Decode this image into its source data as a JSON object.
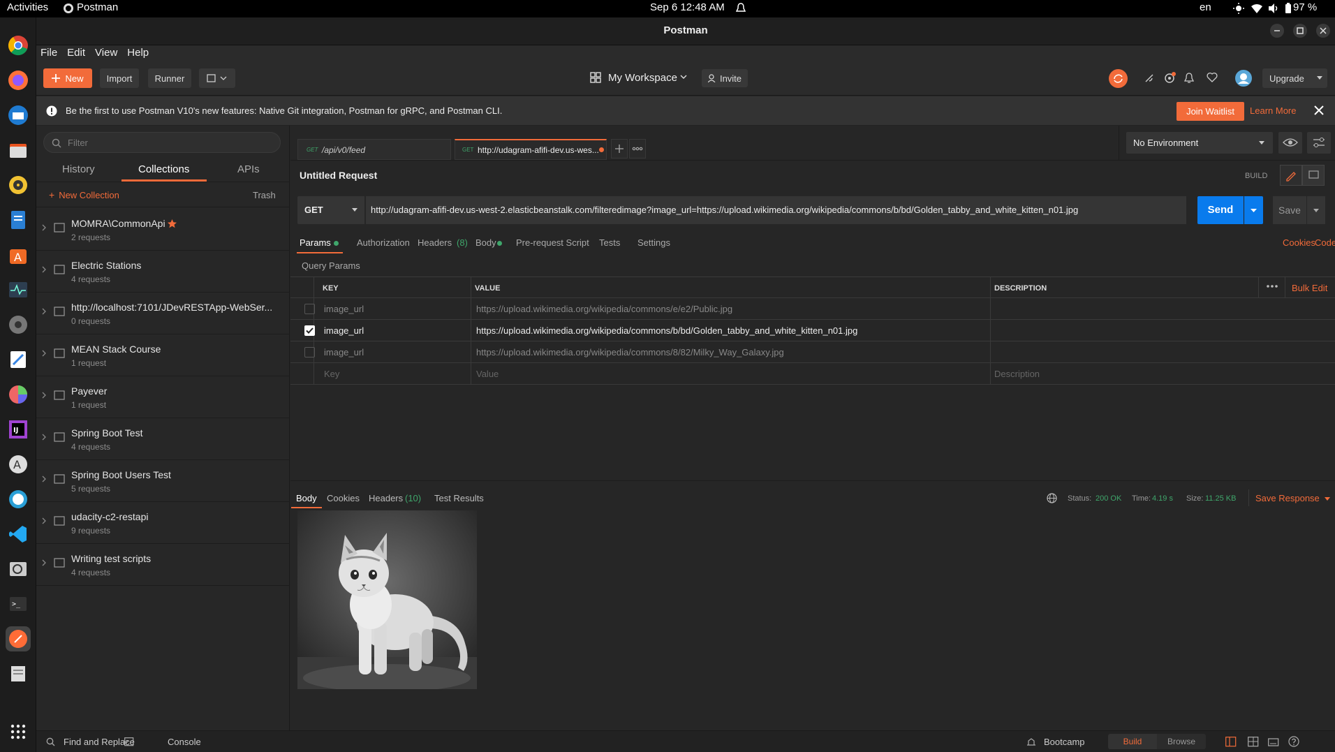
{
  "system": {
    "activities": "Activities",
    "app_name": "Postman",
    "clock": "Sep 6  12:48 AM",
    "lang": "en",
    "battery": "97 %"
  },
  "window": {
    "title": "Postman"
  },
  "menu": [
    "File",
    "Edit",
    "View",
    "Help"
  ],
  "toolbar": {
    "new_label": "New",
    "import_label": "Import",
    "runner_label": "Runner",
    "workspace_label": "My Workspace",
    "invite_label": "Invite",
    "upgrade_label": "Upgrade"
  },
  "banner": {
    "text": "Be the first to use Postman V10's new features: Native Git integration, Postman for gRPC, and Postman CLI.",
    "join_label": "Join Waitlist",
    "learn_label": "Learn More"
  },
  "sidebar": {
    "filter_placeholder": "Filter",
    "tabs": [
      "History",
      "Collections",
      "APIs"
    ],
    "new_collection": "New Collection",
    "trash": "Trash",
    "collections": [
      {
        "name": "MOMRA\\CommonApi",
        "count": "2 requests",
        "starred": true
      },
      {
        "name": "Electric Stations",
        "count": "4 requests"
      },
      {
        "name": "http://localhost:7101/JDevRESTApp-WebSer...",
        "count": "0 requests"
      },
      {
        "name": "MEAN Stack Course",
        "count": "1 request"
      },
      {
        "name": "Payever",
        "count": "1 request"
      },
      {
        "name": "Spring Boot Test",
        "count": "4 requests"
      },
      {
        "name": "Spring Boot Users Test",
        "count": "5 requests"
      },
      {
        "name": "udacity-c2-restapi",
        "count": "9 requests"
      },
      {
        "name": "Writing test scripts",
        "count": "4 requests"
      }
    ]
  },
  "request_tabs": [
    {
      "method": "GET",
      "label": "/api/v0/feed"
    },
    {
      "method": "GET",
      "label": "http://udagram-afifi-dev.us-wes..."
    }
  ],
  "environment": "No Environment",
  "request": {
    "title": "Untitled Request",
    "build_label": "BUILD",
    "method": "GET",
    "url": "http://udagram-afifi-dev.us-west-2.elasticbeanstalk.com/filteredimage?image_url=https://upload.wikimedia.org/wikipedia/commons/b/bd/Golden_tabby_and_white_kitten_n01.jpg",
    "send_label": "Send",
    "save_label": "Save",
    "tabs": [
      "Params",
      "Authorization",
      "Headers",
      "Body",
      "Pre-request Script",
      "Tests",
      "Settings"
    ],
    "headers_count": "(8)",
    "cookies_label": "Cookies",
    "code_label": "Code"
  },
  "params": {
    "section_label": "Query Params",
    "columns": [
      "KEY",
      "VALUE",
      "DESCRIPTION"
    ],
    "bulk_edit": "Bulk Edit",
    "rows": [
      {
        "checked": false,
        "key": "image_url",
        "value": "https://upload.wikimedia.org/wikipedia/commons/e/e2/Public.jpg"
      },
      {
        "checked": true,
        "key": "image_url",
        "value": "https://upload.wikimedia.org/wikipedia/commons/b/bd/Golden_tabby_and_white_kitten_n01.jpg"
      },
      {
        "checked": false,
        "key": "image_url",
        "value": "https://upload.wikimedia.org/wikipedia/commons/8/82/Milky_Way_Galaxy.jpg"
      }
    ],
    "placeholder_key": "Key",
    "placeholder_value": "Value",
    "placeholder_desc": "Description"
  },
  "response": {
    "tabs": [
      "Body",
      "Cookies",
      "Headers",
      "Test Results"
    ],
    "headers_count": "(10)",
    "status_label": "Status:",
    "status_value": "200 OK",
    "time_label": "Time:",
    "time_value": "4.19 s",
    "size_label": "Size:",
    "size_value": "11.25 KB",
    "save_response": "Save Response"
  },
  "statusbar": {
    "find_replace": "Find and Replace",
    "console": "Console",
    "bootcamp": "Bootcamp",
    "build": "Build",
    "browse": "Browse"
  },
  "colors": {
    "accent": "#f26b3a",
    "send_blue": "#097bed",
    "status_green": "#3fa66b"
  }
}
